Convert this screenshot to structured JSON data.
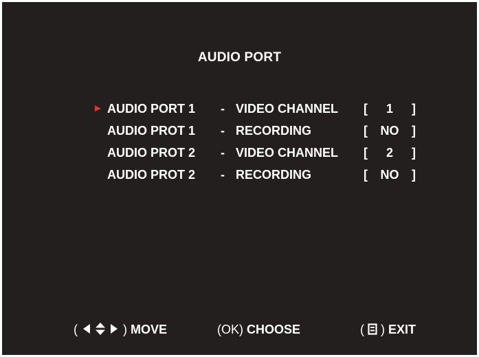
{
  "title": "AUDIO PORT",
  "rows": [
    {
      "port": "AUDIO PORT 1",
      "dash": "-",
      "function": "VIDEO CHANNEL",
      "bracket_open": "[",
      "value": "1",
      "bracket_close": "]"
    },
    {
      "port": "AUDIO PROT 1",
      "dash": "-",
      "function": "RECORDING",
      "bracket_open": "[",
      "value": "NO",
      "bracket_close": "]"
    },
    {
      "port": "AUDIO PROT 2",
      "dash": "-",
      "function": "VIDEO CHANNEL",
      "bracket_open": "[",
      "value": "2",
      "bracket_close": "]"
    },
    {
      "port": "AUDIO PROT 2",
      "dash": "-",
      "function": "RECORDING",
      "bracket_open": "[",
      "value": "NO",
      "bracket_close": "]"
    }
  ],
  "cursor": {
    "glyph": "►",
    "color": "#e8332a"
  },
  "footer": {
    "move": {
      "open": "(",
      "icon": "arrow-keys-icon",
      "close": ")",
      "label": "MOVE"
    },
    "choose": {
      "open": "(",
      "key": "OK",
      "close": ")",
      "label": "CHOOSE"
    },
    "exit": {
      "open": "(",
      "icon": "menu-icon",
      "close": ")",
      "label": "EXIT"
    }
  },
  "colors": {
    "background": "#221f1e",
    "text": "#ffffff",
    "accent": "#e8332a"
  }
}
